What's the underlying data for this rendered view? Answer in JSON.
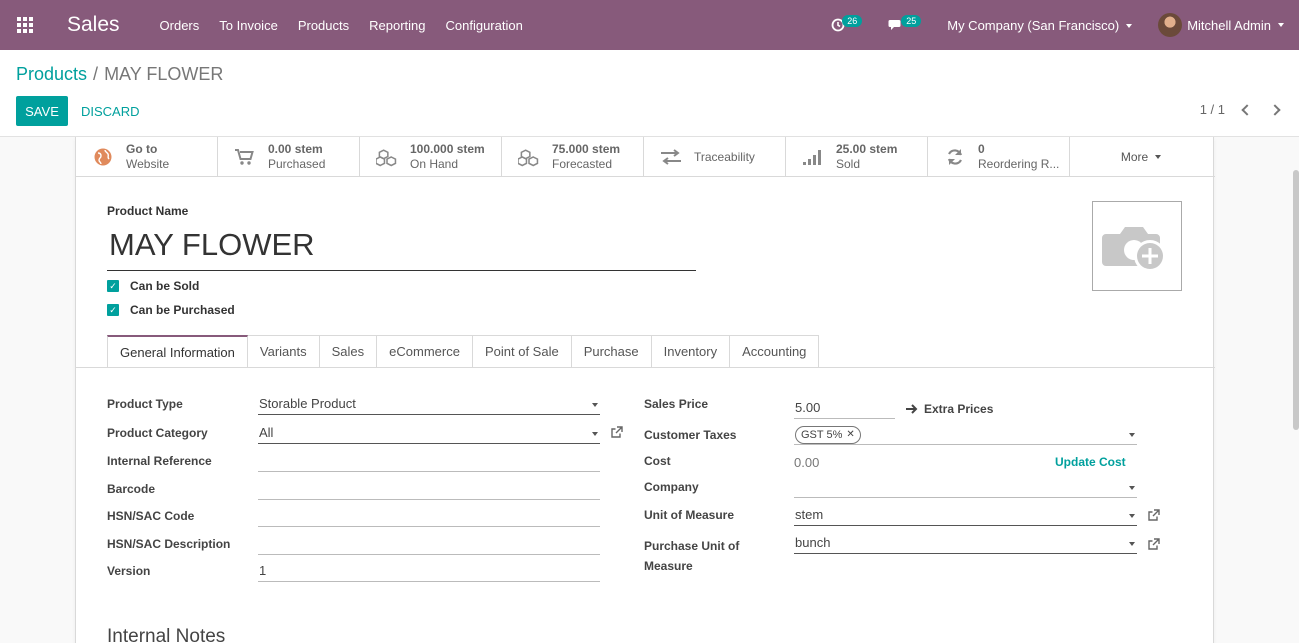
{
  "navbar": {
    "app_name": "Sales",
    "menu": [
      "Orders",
      "To Invoice",
      "Products",
      "Reporting",
      "Configuration"
    ],
    "activity_count": "26",
    "message_count": "25",
    "company": "My Company (San Francisco)",
    "user": "Mitchell Admin",
    "color": "#875a7b"
  },
  "breadcrumb": {
    "parent": "Products",
    "separator": "/",
    "current": "MAY FLOWER"
  },
  "actions": {
    "save": "SAVE",
    "discard": "DISCARD"
  },
  "pager": {
    "value": "1 / 1"
  },
  "smart_buttons": [
    {
      "icon": "globe-icon",
      "value": "Go to",
      "label": "Website"
    },
    {
      "icon": "cart-icon",
      "value": "0.00 stem",
      "label": "Purchased"
    },
    {
      "icon": "cubes-icon",
      "value": "100.000 stem",
      "label": "On Hand"
    },
    {
      "icon": "cubes-icon",
      "value": "75.000 stem",
      "label": "Forecasted"
    },
    {
      "icon": "exchange-icon",
      "value": "",
      "label": "Traceability"
    },
    {
      "icon": "signal-icon",
      "value": "25.00 stem",
      "label": "Sold"
    },
    {
      "icon": "refresh-icon",
      "value": "0",
      "label": "Reordering R..."
    },
    {
      "icon": "caret-icon",
      "value": "",
      "label": "More"
    }
  ],
  "product": {
    "name_label": "Product Name",
    "name": "MAY FLOWER",
    "can_be_sold": "Can be Sold",
    "can_be_purchased": "Can be Purchased"
  },
  "tabs": [
    "General Information",
    "Variants",
    "Sales",
    "eCommerce",
    "Point of Sale",
    "Purchase",
    "Inventory",
    "Accounting"
  ],
  "left_fields": [
    {
      "label": "Product Type",
      "value": "Storable Product"
    },
    {
      "label": "Product Category",
      "value": "All"
    },
    {
      "label": "Internal Reference",
      "value": ""
    },
    {
      "label": "Barcode",
      "value": ""
    },
    {
      "label": "HSN/SAC Code",
      "value": ""
    },
    {
      "label": "HSN/SAC Description",
      "value": ""
    },
    {
      "label": "Version",
      "value": "1"
    }
  ],
  "right_fields": {
    "sales_price_label": "Sales Price",
    "sales_price": "5.00",
    "extra_prices": "Extra Prices",
    "customer_taxes_label": "Customer Taxes",
    "tax_tag": "GST 5%",
    "cost_label": "Cost",
    "cost": "0.00",
    "update_cost": "Update Cost",
    "company_label": "Company",
    "company": "",
    "uom_label": "Unit of Measure",
    "uom": "stem",
    "purchase_uom_label_1": "Purchase Unit of",
    "purchase_uom_label_2": "Measure",
    "purchase_uom": "bunch"
  },
  "notes_title": "Internal Notes",
  "accent": "#00a09d"
}
